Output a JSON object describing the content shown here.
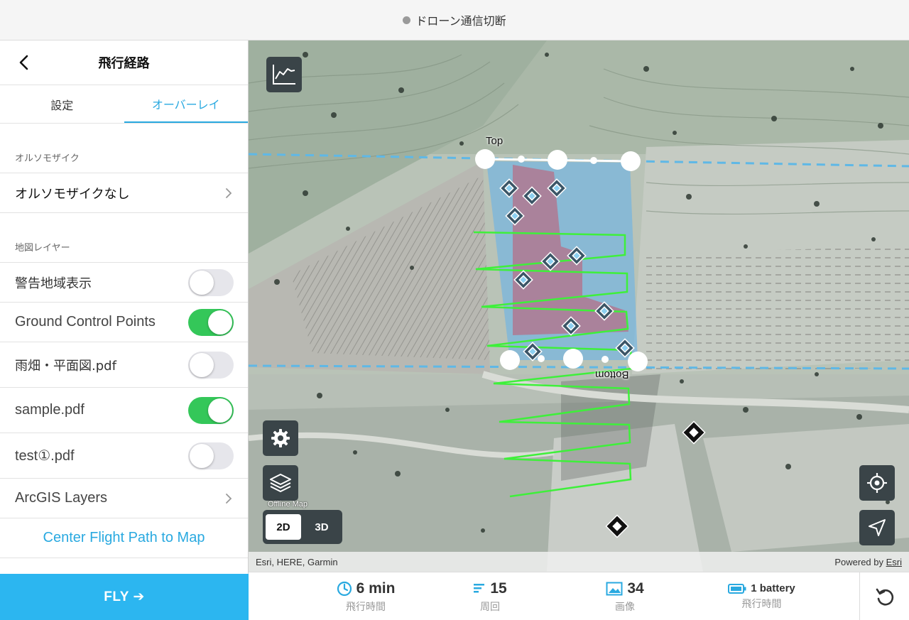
{
  "status": {
    "text": "ドローン通信切断"
  },
  "panel": {
    "title": "飛行経路",
    "tabs": [
      {
        "label": "設定",
        "active": false
      },
      {
        "label": "オーバーレイ",
        "active": true
      }
    ],
    "ortho_section": "オルソモザイク",
    "ortho_value": "オルソモザイクなし",
    "layers_section": "地図レイヤー",
    "layers": [
      {
        "label": "警告地域表示",
        "on": false
      },
      {
        "label": "Ground Control Points",
        "on": true
      },
      {
        "label": "雨畑・平面図.pdf",
        "on": false
      },
      {
        "label": "sample.pdf",
        "on": true
      },
      {
        "label": "test①.pdf",
        "on": false
      }
    ],
    "arcgis": "ArcGIS Layers",
    "center_link": "Center Flight Path to Map",
    "fly": "FLY ➔"
  },
  "map": {
    "label_top": "Top",
    "label_bottom": "Bottom",
    "offline": "Offline Map",
    "dim_2d": "2D",
    "dim_3d": "3D",
    "selected_dim": "2D",
    "attribution_left": "Esri, HERE, Garmin",
    "attribution_powered": "Powered by ",
    "attribution_esri": "Esri",
    "colors": {
      "path": "#3ef03a",
      "area": "#6fb4e3",
      "marker": "#3b5566",
      "accent": "#29a9e0"
    }
  },
  "stats": [
    {
      "value": "6 min",
      "label": "飛行時間",
      "icon": "clock-icon"
    },
    {
      "value": "15",
      "label": "周回",
      "icon": "lines-icon"
    },
    {
      "value": "34",
      "label": "画像",
      "icon": "image-icon"
    },
    {
      "value": "1 battery",
      "label": "飛行時間",
      "icon": "battery-icon"
    }
  ]
}
